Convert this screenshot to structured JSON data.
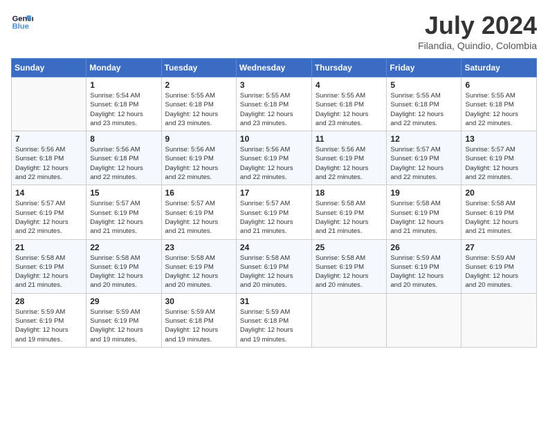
{
  "header": {
    "logo_line1": "General",
    "logo_line2": "Blue",
    "month": "July 2024",
    "location": "Filandia, Quindio, Colombia"
  },
  "weekdays": [
    "Sunday",
    "Monday",
    "Tuesday",
    "Wednesday",
    "Thursday",
    "Friday",
    "Saturday"
  ],
  "weeks": [
    [
      {
        "day": "",
        "info": ""
      },
      {
        "day": "1",
        "info": "Sunrise: 5:54 AM\nSunset: 6:18 PM\nDaylight: 12 hours\nand 23 minutes."
      },
      {
        "day": "2",
        "info": "Sunrise: 5:55 AM\nSunset: 6:18 PM\nDaylight: 12 hours\nand 23 minutes."
      },
      {
        "day": "3",
        "info": "Sunrise: 5:55 AM\nSunset: 6:18 PM\nDaylight: 12 hours\nand 23 minutes."
      },
      {
        "day": "4",
        "info": "Sunrise: 5:55 AM\nSunset: 6:18 PM\nDaylight: 12 hours\nand 23 minutes."
      },
      {
        "day": "5",
        "info": "Sunrise: 5:55 AM\nSunset: 6:18 PM\nDaylight: 12 hours\nand 22 minutes."
      },
      {
        "day": "6",
        "info": "Sunrise: 5:55 AM\nSunset: 6:18 PM\nDaylight: 12 hours\nand 22 minutes."
      }
    ],
    [
      {
        "day": "7",
        "info": "Sunrise: 5:56 AM\nSunset: 6:18 PM\nDaylight: 12 hours\nand 22 minutes."
      },
      {
        "day": "8",
        "info": "Sunrise: 5:56 AM\nSunset: 6:18 PM\nDaylight: 12 hours\nand 22 minutes."
      },
      {
        "day": "9",
        "info": "Sunrise: 5:56 AM\nSunset: 6:19 PM\nDaylight: 12 hours\nand 22 minutes."
      },
      {
        "day": "10",
        "info": "Sunrise: 5:56 AM\nSunset: 6:19 PM\nDaylight: 12 hours\nand 22 minutes."
      },
      {
        "day": "11",
        "info": "Sunrise: 5:56 AM\nSunset: 6:19 PM\nDaylight: 12 hours\nand 22 minutes."
      },
      {
        "day": "12",
        "info": "Sunrise: 5:57 AM\nSunset: 6:19 PM\nDaylight: 12 hours\nand 22 minutes."
      },
      {
        "day": "13",
        "info": "Sunrise: 5:57 AM\nSunset: 6:19 PM\nDaylight: 12 hours\nand 22 minutes."
      }
    ],
    [
      {
        "day": "14",
        "info": "Sunrise: 5:57 AM\nSunset: 6:19 PM\nDaylight: 12 hours\nand 22 minutes."
      },
      {
        "day": "15",
        "info": "Sunrise: 5:57 AM\nSunset: 6:19 PM\nDaylight: 12 hours\nand 21 minutes."
      },
      {
        "day": "16",
        "info": "Sunrise: 5:57 AM\nSunset: 6:19 PM\nDaylight: 12 hours\nand 21 minutes."
      },
      {
        "day": "17",
        "info": "Sunrise: 5:57 AM\nSunset: 6:19 PM\nDaylight: 12 hours\nand 21 minutes."
      },
      {
        "day": "18",
        "info": "Sunrise: 5:58 AM\nSunset: 6:19 PM\nDaylight: 12 hours\nand 21 minutes."
      },
      {
        "day": "19",
        "info": "Sunrise: 5:58 AM\nSunset: 6:19 PM\nDaylight: 12 hours\nand 21 minutes."
      },
      {
        "day": "20",
        "info": "Sunrise: 5:58 AM\nSunset: 6:19 PM\nDaylight: 12 hours\nand 21 minutes."
      }
    ],
    [
      {
        "day": "21",
        "info": "Sunrise: 5:58 AM\nSunset: 6:19 PM\nDaylight: 12 hours\nand 21 minutes."
      },
      {
        "day": "22",
        "info": "Sunrise: 5:58 AM\nSunset: 6:19 PM\nDaylight: 12 hours\nand 20 minutes."
      },
      {
        "day": "23",
        "info": "Sunrise: 5:58 AM\nSunset: 6:19 PM\nDaylight: 12 hours\nand 20 minutes."
      },
      {
        "day": "24",
        "info": "Sunrise: 5:58 AM\nSunset: 6:19 PM\nDaylight: 12 hours\nand 20 minutes."
      },
      {
        "day": "25",
        "info": "Sunrise: 5:58 AM\nSunset: 6:19 PM\nDaylight: 12 hours\nand 20 minutes."
      },
      {
        "day": "26",
        "info": "Sunrise: 5:59 AM\nSunset: 6:19 PM\nDaylight: 12 hours\nand 20 minutes."
      },
      {
        "day": "27",
        "info": "Sunrise: 5:59 AM\nSunset: 6:19 PM\nDaylight: 12 hours\nand 20 minutes."
      }
    ],
    [
      {
        "day": "28",
        "info": "Sunrise: 5:59 AM\nSunset: 6:19 PM\nDaylight: 12 hours\nand 19 minutes."
      },
      {
        "day": "29",
        "info": "Sunrise: 5:59 AM\nSunset: 6:19 PM\nDaylight: 12 hours\nand 19 minutes."
      },
      {
        "day": "30",
        "info": "Sunrise: 5:59 AM\nSunset: 6:18 PM\nDaylight: 12 hours\nand 19 minutes."
      },
      {
        "day": "31",
        "info": "Sunrise: 5:59 AM\nSunset: 6:18 PM\nDaylight: 12 hours\nand 19 minutes."
      },
      {
        "day": "",
        "info": ""
      },
      {
        "day": "",
        "info": ""
      },
      {
        "day": "",
        "info": ""
      }
    ]
  ]
}
